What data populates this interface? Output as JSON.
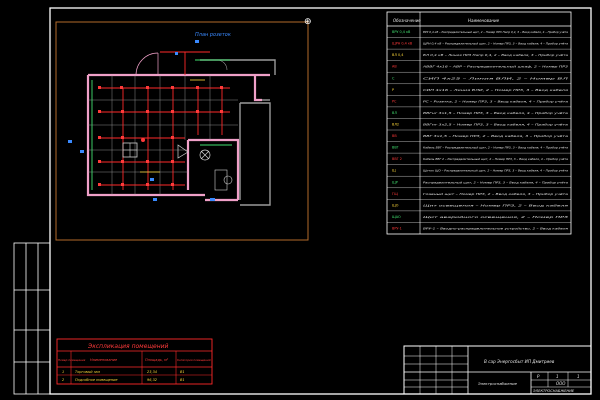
{
  "plan": {
    "label": "План розеток",
    "crosshair": "⊕"
  },
  "legend": {
    "headers": [
      "Обозначение",
      "Наименование"
    ],
    "rows": [
      {
        "symbol": "ВРУ 0,4 кВ",
        "text": "ВРУ 0,4 кВ – Распределительный щит, 2 – Номер ПРЗ Напр 0,4, 3 – Ввод кабеля, 4 – Прибор учёта"
      },
      {
        "symbol": "ЩРН 0,4 кВ",
        "text": "ЩРН 0,4 кВ – Распределительный щит, 2 – Номер ПРЗ, 3 – Ввод кабеля, 4 – Прибор учёта"
      },
      {
        "symbol": "ВЛ 0,4",
        "text": "ВЛ 0,4 кВ – Линия ПРЗ Напр 0,4, 2 – Ввод кабеля, 3 – Прибор учёта"
      },
      {
        "symbol": "АВ",
        "text": "АВВГ 4х16 – АВР – Распределительный шкаф, 2 – Номер ПРЗ"
      },
      {
        "symbol": "С",
        "text": "СИП 4х25 – Линия ВЛИ, 2 – Номер ВЛ"
      },
      {
        "symbol": "Р",
        "text": "СИП 4х16 – Линия ВЛИ, 2 – Номер ПРЗ, 3 – Ввод кабеля"
      },
      {
        "symbol": "РС",
        "text": "РС – Розетка, 2 – Номер ПРЗ, 3 – Ввод кабеля, 4 – Прибор учёта"
      },
      {
        "symbol": "ВЛ",
        "text": "ВВГнг 3х1,5 – Номер ПРЗ, 3 – Ввод кабеля, 4 – Прибор учёта"
      },
      {
        "symbol": "ВЛ2",
        "text": "ВВГнг 3х2,5 – Номер ПРЗ, 3 – Ввод кабеля, 4 – Прибор учёта"
      },
      {
        "symbol": "ВВ",
        "text": "ВВГ 3х1,5 – Номер ПРЗ, 2 – Ввод кабеля, 3 – Прибор учёта"
      },
      {
        "symbol": "ВВГ",
        "text": "Кабель ВВГ – Распределительный щит, 2 – Номер ПРЗ, 3 – Ввод кабеля, 4 – Прибор учёта"
      },
      {
        "symbol": "ВВГ 2",
        "text": "Кабель ВВГ 2 – Распределительный щит, 2 – Номер ПРЗ, 3 – Ввод кабеля, 4 – Прибор учёта"
      },
      {
        "symbol": "Щ",
        "text": "Щиток ЩО – Распределительный щит, 2 – Номер ПРЗ, 3 – Ввод кабеля, 4 – Прибор учёта"
      },
      {
        "symbol": "ЩР",
        "text": "Распределительный щит, 2 – Номер ПРЗ, 3 – Ввод кабеля, 4 – Прибор учёта"
      },
      {
        "symbol": "ГЩ",
        "text": "Главный щит – Номер ПРЗ, 2 – Ввод кабеля, 3 – Прибор учёта"
      },
      {
        "symbol": "ЩО",
        "text": "Щит освещения – Номер ПРЗ, 2 – Ввод кабеля"
      },
      {
        "symbol": "ЩАО",
        "text": "Щит аварийного освещения, 2 – Номер ПРЗ"
      },
      {
        "symbol": "ВРУ-1",
        "text": "ВРУ-1 – Вводно-распределительное устройство, 2 – Ввод кабеля"
      }
    ]
  },
  "explication": {
    "title": "Экспликация помещений",
    "headers": [
      "Номер помещения",
      "Наименование",
      "Площадь, м²",
      "Категория помещений"
    ],
    "rows": [
      {
        "num": "1",
        "name": "Торговый зал",
        "area": "23,34",
        "cat": "В1"
      },
      {
        "num": "2",
        "name": "Подсобное помещение",
        "area": "96,32",
        "cat": "В1"
      }
    ]
  },
  "stamp": {
    "project": "В сар Энергосбыт ИП Дмитриев",
    "title": "Электроснабжение",
    "stage": "Р",
    "sheet": "1",
    "sheets": "1",
    "org": "ООО",
    "code": "ЭЛЕКТРОСНАБЖЕНИЕ"
  },
  "colors": {
    "frame": "#ffffff",
    "plan_border": "#b26a2a",
    "walls": "#f0a0c8",
    "wiring": "#ff2a2a",
    "equipment": "#3a8aff",
    "green": "#42e070"
  }
}
